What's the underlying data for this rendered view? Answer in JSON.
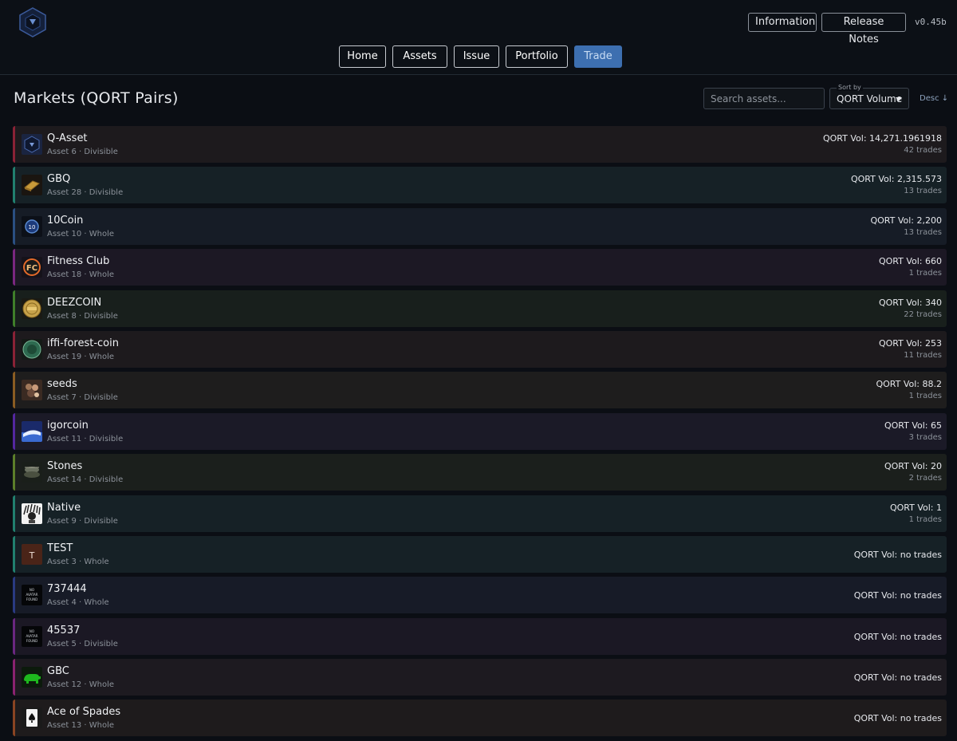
{
  "header": {
    "logo": "q-logo-icon",
    "buttons": {
      "information": "Information",
      "release_notes": "Release Notes"
    },
    "version": "v0.45b",
    "nav": [
      {
        "label": "Home",
        "active": false
      },
      {
        "label": "Assets",
        "active": false
      },
      {
        "label": "Issue",
        "active": false
      },
      {
        "label": "Portfolio",
        "active": false
      },
      {
        "label": "Trade",
        "active": true
      }
    ]
  },
  "toolbar": {
    "title": "Markets (QORT Pairs)",
    "search_placeholder": "Search assets...",
    "sort_label": "Sort by",
    "sort_value": "QORT Volume",
    "order_toggle": "Desc ↓"
  },
  "markets": [
    {
      "name": "Q-Asset",
      "meta": "Asset 6 · Divisible",
      "vol": "QORT Vol: 14,271.1961918",
      "trades": "42 trades",
      "accent": "#8a2236",
      "bg": "#1d1a1d",
      "avatar": "q-asset-icon"
    },
    {
      "name": "GBQ",
      "meta": "Asset 28 · Divisible",
      "vol": "QORT Vol: 2,315.573",
      "trades": "13 trades",
      "accent": "#21806f",
      "bg": "#162126",
      "avatar": "gold-bar-icon"
    },
    {
      "name": "10Coin",
      "meta": "Asset 10 · Whole",
      "vol": "QORT Vol: 2,200",
      "trades": "13 trades",
      "accent": "#2a4f82",
      "bg": "#161c26",
      "avatar": "ten-coin-icon"
    },
    {
      "name": "Fitness Club",
      "meta": "Asset 18 · Whole",
      "vol": "QORT Vol: 660",
      "trades": "1 trades",
      "accent": "#7a2780",
      "bg": "#1c1824",
      "avatar": "fc-badge-icon"
    },
    {
      "name": "DEEZCOIN",
      "meta": "Asset 8 · Divisible",
      "vol": "QORT Vol: 340",
      "trades": "22 trades",
      "accent": "#3f7f2a",
      "bg": "#181f1c",
      "avatar": "gold-coin-icon"
    },
    {
      "name": "iffi-forest-coin",
      "meta": "Asset 19 · Whole",
      "vol": "QORT Vol: 253",
      "trades": "11 trades",
      "accent": "#8a2236",
      "bg": "#1d1a1d",
      "avatar": "green-coin-icon"
    },
    {
      "name": "seeds",
      "meta": "Asset 7 · Divisible",
      "vol": "QORT Vol: 88.2",
      "trades": "1 trades",
      "accent": "#8a5c22",
      "bg": "#1e1d1d",
      "avatar": "seeds-icon"
    },
    {
      "name": "igorcoin",
      "meta": "Asset 11 · Divisible",
      "vol": "QORT Vol: 65",
      "trades": "3 trades",
      "accent": "#5427a0",
      "bg": "#1b1a27",
      "avatar": "blue-sky-icon"
    },
    {
      "name": "Stones",
      "meta": "Asset 14 · Divisible",
      "vol": "QORT Vol: 20",
      "trades": "2 trades",
      "accent": "#5c7f2a",
      "bg": "#1b1f1c",
      "avatar": "stones-icon"
    },
    {
      "name": "Native",
      "meta": "Asset 9 · Divisible",
      "vol": "QORT Vol: 1",
      "trades": "1 trades",
      "accent": "#21806f",
      "bg": "#162126",
      "avatar": "native-headdress-icon"
    },
    {
      "name": "TEST",
      "meta": "Asset 3 · Whole",
      "vol": "QORT Vol: no trades",
      "trades": "",
      "accent": "#21806f",
      "bg": "#162126",
      "avatar": "letter-t-icon",
      "avatar_letter": "T"
    },
    {
      "name": "737444",
      "meta": "Asset 4 · Whole",
      "vol": "QORT Vol: no trades",
      "trades": "",
      "accent": "#2a3a82",
      "bg": "#171b27",
      "avatar": "no-avatar-icon",
      "avatar_text": "NO AVATAR FOUND"
    },
    {
      "name": "45537",
      "meta": "Asset 5 · Divisible",
      "vol": "QORT Vol: no trades",
      "trades": "",
      "accent": "#6a2780",
      "bg": "#1b1824",
      "avatar": "no-avatar-icon",
      "avatar_text": "NO AVATAR FOUND"
    },
    {
      "name": "GBC",
      "meta": "Asset 12 · Whole",
      "vol": "QORT Vol: no trades",
      "trades": "",
      "accent": "#8a2270",
      "bg": "#1d1a20",
      "avatar": "bear-icon"
    },
    {
      "name": "Ace of Spades",
      "meta": "Asset 13 · Whole",
      "vol": "QORT Vol: no trades",
      "trades": "",
      "accent": "#8a4422",
      "bg": "#1e1b1c",
      "avatar": "spade-card-icon"
    }
  ]
}
